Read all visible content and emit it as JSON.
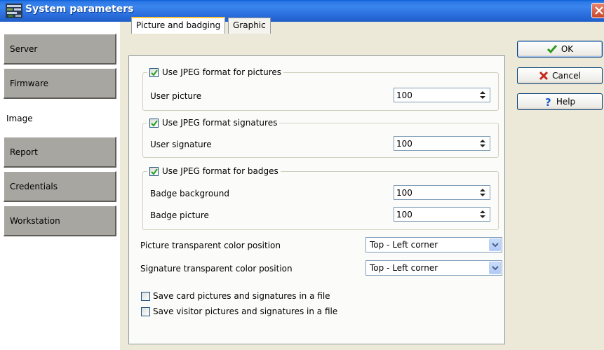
{
  "window": {
    "title": "System parameters"
  },
  "sidebar": {
    "items": [
      {
        "label": "Server",
        "active": false
      },
      {
        "label": "Firmware",
        "active": false
      },
      {
        "label": "Image",
        "active": true
      },
      {
        "label": "Report",
        "active": false
      },
      {
        "label": "Credentials",
        "active": false
      },
      {
        "label": "Workstation",
        "active": false
      }
    ]
  },
  "tabs": [
    {
      "label": "Picture and badging",
      "active": true
    },
    {
      "label": "Graphic",
      "active": false
    }
  ],
  "pictures_group": {
    "checkbox_label": "Use JPEG format for pictures",
    "checked": true,
    "user_picture": {
      "label": "User picture",
      "value": "100"
    }
  },
  "signatures_group": {
    "checkbox_label": "Use JPEG format signatures",
    "checked": true,
    "user_signature": {
      "label": "User signature",
      "value": "100"
    }
  },
  "badges_group": {
    "checkbox_label": "Use JPEG format for badges",
    "checked": true,
    "badge_background": {
      "label": "Badge background",
      "value": "100"
    },
    "badge_picture": {
      "label": "Badge picture",
      "value": "100"
    }
  },
  "picture_transparent": {
    "label": "Picture transparent color position",
    "value": "Top - Left corner"
  },
  "signature_transparent": {
    "label": "Signature transparent color position",
    "value": "Top - Left corner"
  },
  "save_card": {
    "label": "Save card pictures and signatures in a file",
    "checked": false
  },
  "save_visitor": {
    "label": "Save visitor pictures and signatures in a file",
    "checked": false
  },
  "buttons": {
    "ok": "OK",
    "cancel": "Cancel",
    "help": "Help"
  },
  "icons": {
    "ok": "check-icon",
    "cancel": "x-icon",
    "help": "question-icon",
    "close": "close-icon",
    "app": "app-icon"
  }
}
